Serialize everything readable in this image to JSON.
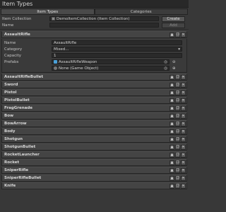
{
  "window": {
    "title": "Item Types"
  },
  "tabs": [
    {
      "label": "Item Types",
      "active": true
    },
    {
      "label": "Categories",
      "active": false
    }
  ],
  "collection": {
    "label": "Item Collection",
    "value": "DemoItemCollection (Item Collection)",
    "create_label": "Create",
    "name_label": "Name",
    "add_label": "Add"
  },
  "expanded": {
    "title": "AssaultRifle",
    "fields": {
      "name_label": "Name",
      "name_value": "AssaultRifle",
      "category_label": "Category",
      "category_value": "Mixed...",
      "capacity_label": "Capacity",
      "capacity_value": "1",
      "prefabs_label": "Prefabs",
      "prefab1": "AssaultRifleWeapon",
      "prefab2": "None (Game Object)"
    }
  },
  "items": [
    "AssaultRifleBullet",
    "Sword",
    "Pistol",
    "PistolBullet",
    "FragGrenade",
    "Bow",
    "BowArrow",
    "Body",
    "Shotgun",
    "ShotgunBullet",
    "RocketLauncher",
    "Rocket",
    "SniperRifle",
    "SniperRifleBullet",
    "Knife"
  ],
  "icons": {
    "up": "arrow-up-icon",
    "duplicate": "duplicate-icon",
    "remove": "close-icon",
    "prefab": "prefab-cube-icon",
    "target": "object-picker-icon",
    "remove_prefab": "minus-icon",
    "add_prefab": "plus-icon",
    "dropdown": "chevron-down-icon",
    "object_field": "object-field-icon"
  },
  "colors": {
    "background": "#383838",
    "header": "#444444",
    "field": "#2a2a2a",
    "accent_prefab": "#4aa0d8"
  }
}
